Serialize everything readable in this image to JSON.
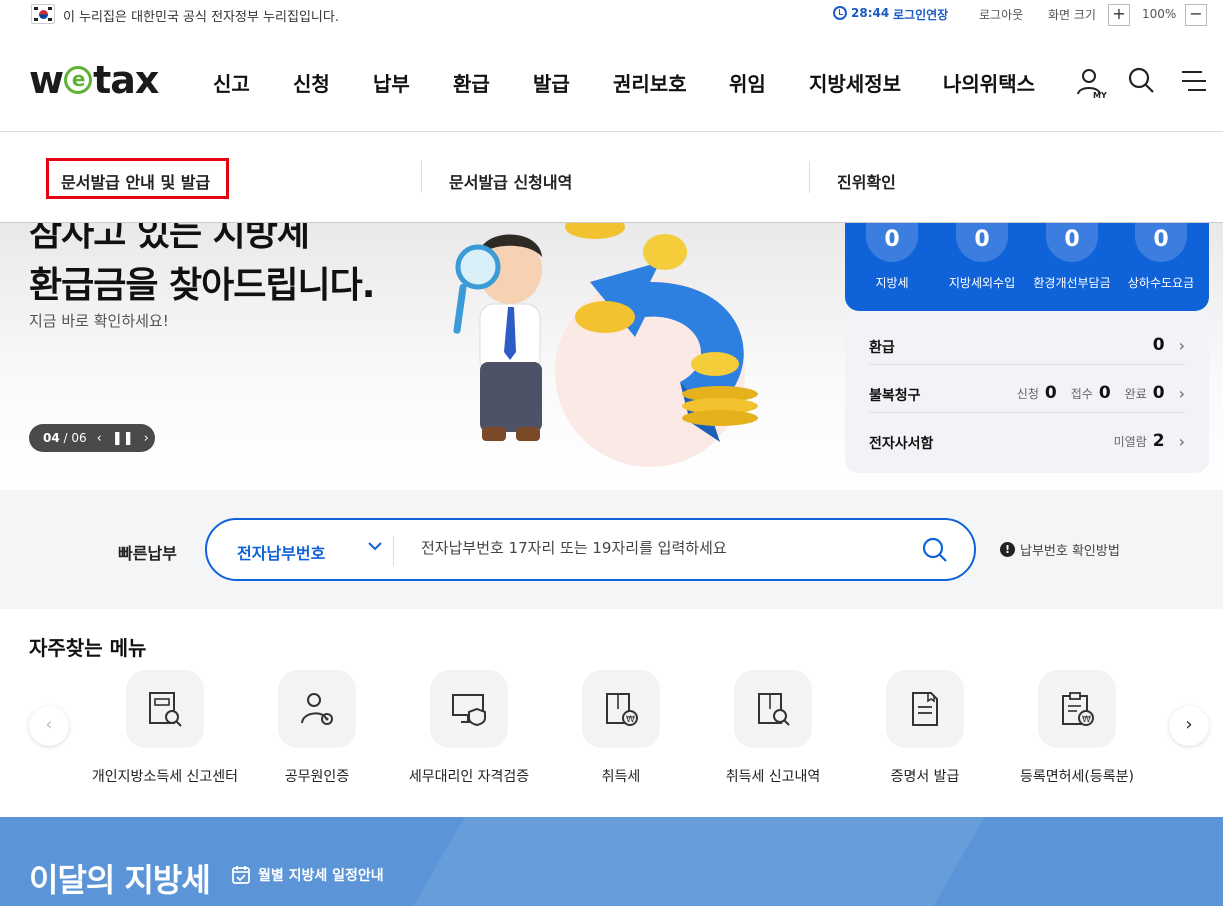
{
  "gov_banner": {
    "text": "이 누리집은 대한민국 공식 전자정부 누리집입니다.",
    "timer": "28:44",
    "extend_label": "로그인연장",
    "logout_label": "로그아웃",
    "zoom_label": "화면 크기",
    "zoom_in": "+",
    "zoom_value": "100%",
    "zoom_out": "−"
  },
  "header": {
    "logo": {
      "w": "w",
      "e": "e",
      "rest": "tax"
    },
    "nav": [
      "신고",
      "신청",
      "납부",
      "환급",
      "발급",
      "권리보호",
      "위임",
      "지방세정보",
      "나의위택스"
    ],
    "my_label": "MY"
  },
  "submenu": {
    "items": [
      "문서발급 안내 및 발급",
      "문서발급 신청내역",
      "진위확인"
    ]
  },
  "hero": {
    "title_line1": "잠자고 있는 지방세",
    "title_line2": "환급금을 찾아드립니다.",
    "subtitle": "지금 바로 확인하세요!",
    "page_current": "04",
    "page_total": "/ 06"
  },
  "panel": {
    "counts": [
      {
        "value": "0",
        "label": "지방세"
      },
      {
        "value": "0",
        "label": "지방세외수입"
      },
      {
        "value": "0",
        "label": "환경개선부담금"
      },
      {
        "value": "0",
        "label": "상하수도요금"
      }
    ],
    "refund": {
      "label": "환급",
      "value": "0"
    },
    "appeal": {
      "label": "불복청구",
      "items": [
        {
          "label": "신청",
          "value": "0"
        },
        {
          "label": "접수",
          "value": "0"
        },
        {
          "label": "완료",
          "value": "0"
        }
      ]
    },
    "edoc": {
      "label": "전자사서함",
      "sub_label": "미열람",
      "value": "2"
    }
  },
  "quick_pay": {
    "label": "빠른납부",
    "select_value": "전자납부번호",
    "placeholder": "전자납부번호 17자리 또는 19자리를 입력하세요",
    "help": "납부번호 확인방법"
  },
  "frequent": {
    "title": "자주찾는 메뉴",
    "items": [
      {
        "label": "개인지방소득세 신고센터",
        "icon": "report-search-icon"
      },
      {
        "label": "공무원인증",
        "icon": "official-cert-icon"
      },
      {
        "label": "세무대리인 자격검증",
        "icon": "monitor-shield-icon"
      },
      {
        "label": "취득세",
        "icon": "tax-document-icon"
      },
      {
        "label": "취득세 신고내역",
        "icon": "document-search-icon"
      },
      {
        "label": "증명서 발급",
        "icon": "certificate-icon"
      },
      {
        "label": "등록면허세(등록분)",
        "icon": "clipboard-tax-icon"
      }
    ]
  },
  "monthly": {
    "title": "이달의 지방세",
    "link": "월별 지방세 일정안내"
  },
  "colors": {
    "primary_blue": "#1062d8",
    "highlight_red": "#e60012",
    "logo_green": "#5db234",
    "monthly_bg": "#5b95d8"
  }
}
